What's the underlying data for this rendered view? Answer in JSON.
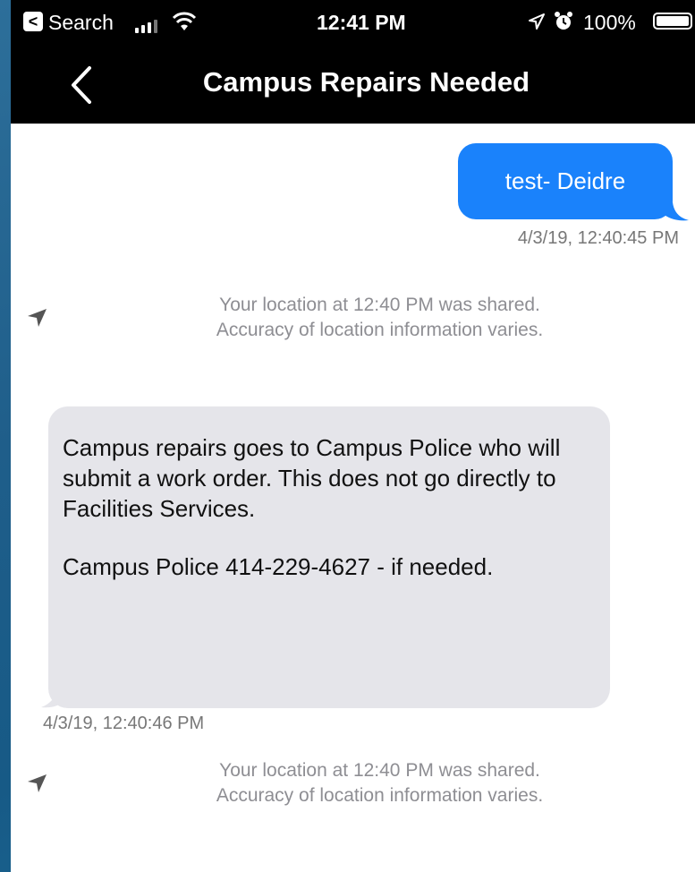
{
  "status_bar": {
    "back_app": "Search",
    "time": "12:41 PM",
    "battery": "100%",
    "back_glyph": "<"
  },
  "header": {
    "title": "Campus Repairs Needed"
  },
  "messages": [
    {
      "direction": "outgoing",
      "text": "test- Deidre",
      "timestamp": "4/3/19, 12:40:45 PM"
    },
    {
      "type": "location",
      "line1": "Your location at 12:40 PM was shared.",
      "line2": "Accuracy of location information varies."
    },
    {
      "direction": "incoming",
      "paragraph1": "Campus repairs goes to Campus Police who will submit a work order.  This does not go directly to Facilities Services.",
      "paragraph2": "Campus Police 414-229-4627 - if needed.",
      "timestamp": "4/3/19, 12:40:46 PM"
    },
    {
      "type": "location",
      "line1": "Your location at 12:40 PM was shared.",
      "line2": "Accuracy of location information varies."
    }
  ],
  "icons": {
    "back": "chevron-left-icon",
    "location": "location-arrow-icon",
    "wifi": "wifi-icon",
    "alarm": "alarm-icon",
    "signal": "signal-icon",
    "battery": "battery-icon"
  },
  "colors": {
    "outgoing_bubble": "#1a82fb",
    "incoming_bubble": "#e5e5ea",
    "header_bg": "#000000"
  }
}
